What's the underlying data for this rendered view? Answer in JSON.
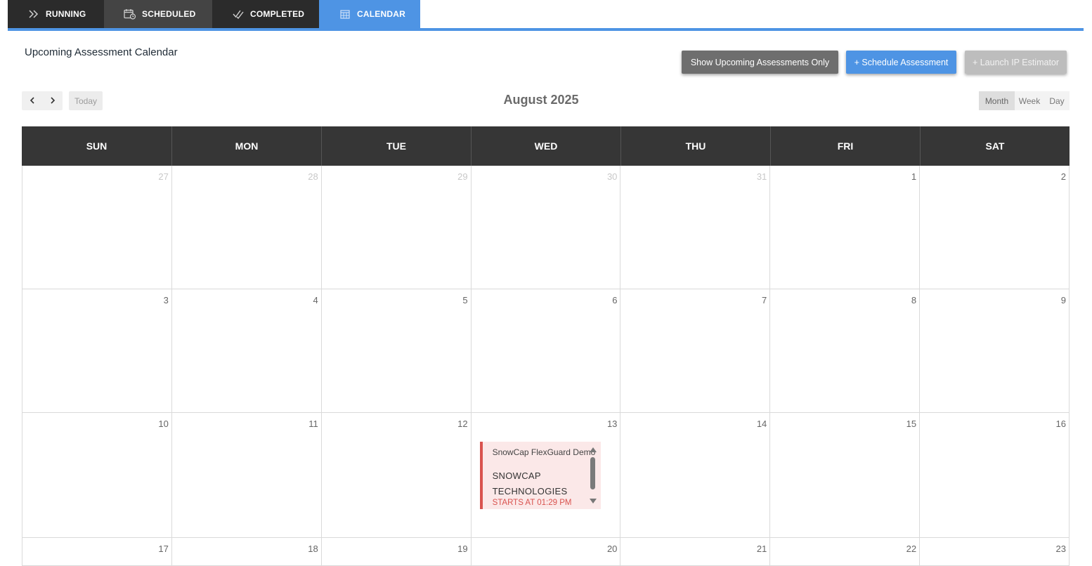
{
  "tabs": [
    {
      "label": "RUNNING",
      "icon": "double-chevron-right-icon"
    },
    {
      "label": "SCHEDULED",
      "icon": "calendar-clock-icon"
    },
    {
      "label": "COMPLETED",
      "icon": "double-check-icon"
    },
    {
      "label": "CALENDAR",
      "icon": "calendar-grid-icon",
      "active": true
    }
  ],
  "header": {
    "title": "Upcoming Assessment Calendar",
    "buttons": {
      "upcoming": "Show Upcoming Assessments Only",
      "schedule": "+ Schedule Assessment",
      "launch": "+ Launch IP Estimator"
    }
  },
  "toolbar": {
    "prev_icon": "chevron-left-icon",
    "next_icon": "chevron-right-icon",
    "today": "Today",
    "month_title": "August 2025",
    "views": {
      "month": "Month",
      "week": "Week",
      "day": "Day"
    },
    "active_view": "Month"
  },
  "calendar": {
    "weekdays": [
      "SUN",
      "MON",
      "TUE",
      "WED",
      "THU",
      "FRI",
      "SAT"
    ],
    "weeks": [
      [
        "27",
        "28",
        "29",
        "30",
        "31",
        "1",
        "2"
      ],
      [
        "3",
        "4",
        "5",
        "6",
        "7",
        "8",
        "9"
      ],
      [
        "10",
        "11",
        "12",
        "13",
        "14",
        "15",
        "16"
      ],
      [
        "17",
        "18",
        "19",
        "20",
        "21",
        "22",
        "23"
      ]
    ],
    "other_month_days_first_week": 5
  },
  "event": {
    "day": "13",
    "name": "SnowCap FlexGuard Demo",
    "company": "SNOWCAP TECHNOLOGIES",
    "time": "STARTS AT 01:29 PM"
  },
  "colors": {
    "accent": "#4e94e4",
    "tab_dark": "#2b2b2b",
    "header_dark": "#363636",
    "event_bg": "#fbe8e8",
    "event_accent": "#d9534f"
  }
}
